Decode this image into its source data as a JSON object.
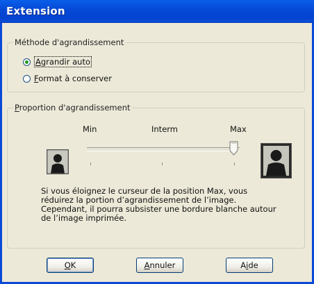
{
  "window": {
    "title": "Extension"
  },
  "method_group": {
    "legend": "Méthode d'agrandissement",
    "options": [
      {
        "label": "Agrandir auto",
        "selected": true
      },
      {
        "label": "Format à conserver",
        "selected": false
      }
    ]
  },
  "proportion_group": {
    "legend": "Proportion d'agrandissement",
    "min_label": "Min",
    "interm_label": "Interm",
    "max_label": "Max",
    "slider_value": "Max",
    "description_lines": [
      "Si vous éloignez le curseur de la position Max, vous",
      "réduirez la portion d’agrandissement de l’image.",
      "Cependant, il pourra subsister une bordure blanche autour",
      "de l’image imprimée."
    ]
  },
  "buttons": {
    "ok": "OK",
    "cancel": "Annuler",
    "help": "Aide"
  }
}
